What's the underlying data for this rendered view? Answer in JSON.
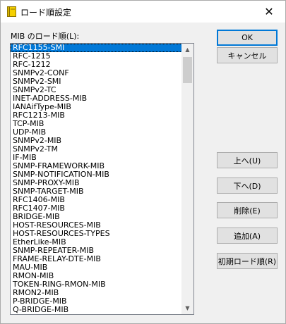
{
  "window": {
    "title": "ロード順設定",
    "close_glyph": "✕"
  },
  "list": {
    "label": "MIB のロード順(L):",
    "items": [
      "RFC1155-SMI",
      "RFC-1215",
      "RFC-1212",
      "SNMPv2-CONF",
      "SNMPv2-SMI",
      "SNMPv2-TC",
      "INET-ADDRESS-MIB",
      "IANAifType-MIB",
      "RFC1213-MIB",
      "TCP-MIB",
      "UDP-MIB",
      "SNMPv2-MIB",
      "SNMPv2-TM",
      "IF-MIB",
      "SNMP-FRAMEWORK-MIB",
      "SNMP-NOTIFICATION-MIB",
      "SNMP-PROXY-MIB",
      "SNMP-TARGET-MIB",
      "RFC1406-MIB",
      "RFC1407-MIB",
      "BRIDGE-MIB",
      "HOST-RESOURCES-MIB",
      "HOST-RESOURCES-TYPES",
      "EtherLike-MIB",
      "SNMP-REPEATER-MIB",
      "FRAME-RELAY-DTE-MIB",
      "MAU-MIB",
      "RMON-MIB",
      "TOKEN-RING-RMON-MIB",
      "RMON2-MIB",
      "P-BRIDGE-MIB",
      "Q-BRIDGE-MIB"
    ],
    "selected_index": 0
  },
  "buttons": {
    "ok": "OK",
    "cancel": "キャンセル",
    "up": "上へ(U)",
    "down": "下へ(D)",
    "delete": "削除(E)",
    "add": "追加(A)",
    "reset": "初期ロード順(R)"
  },
  "icons": {
    "app": "notebook-icon",
    "close": "close-icon",
    "scroll_up": "scroll-up-arrow-icon",
    "scroll_down": "scroll-down-arrow-icon"
  },
  "colors": {
    "selection": "#0078d7",
    "app_icon": "#e8c000"
  }
}
